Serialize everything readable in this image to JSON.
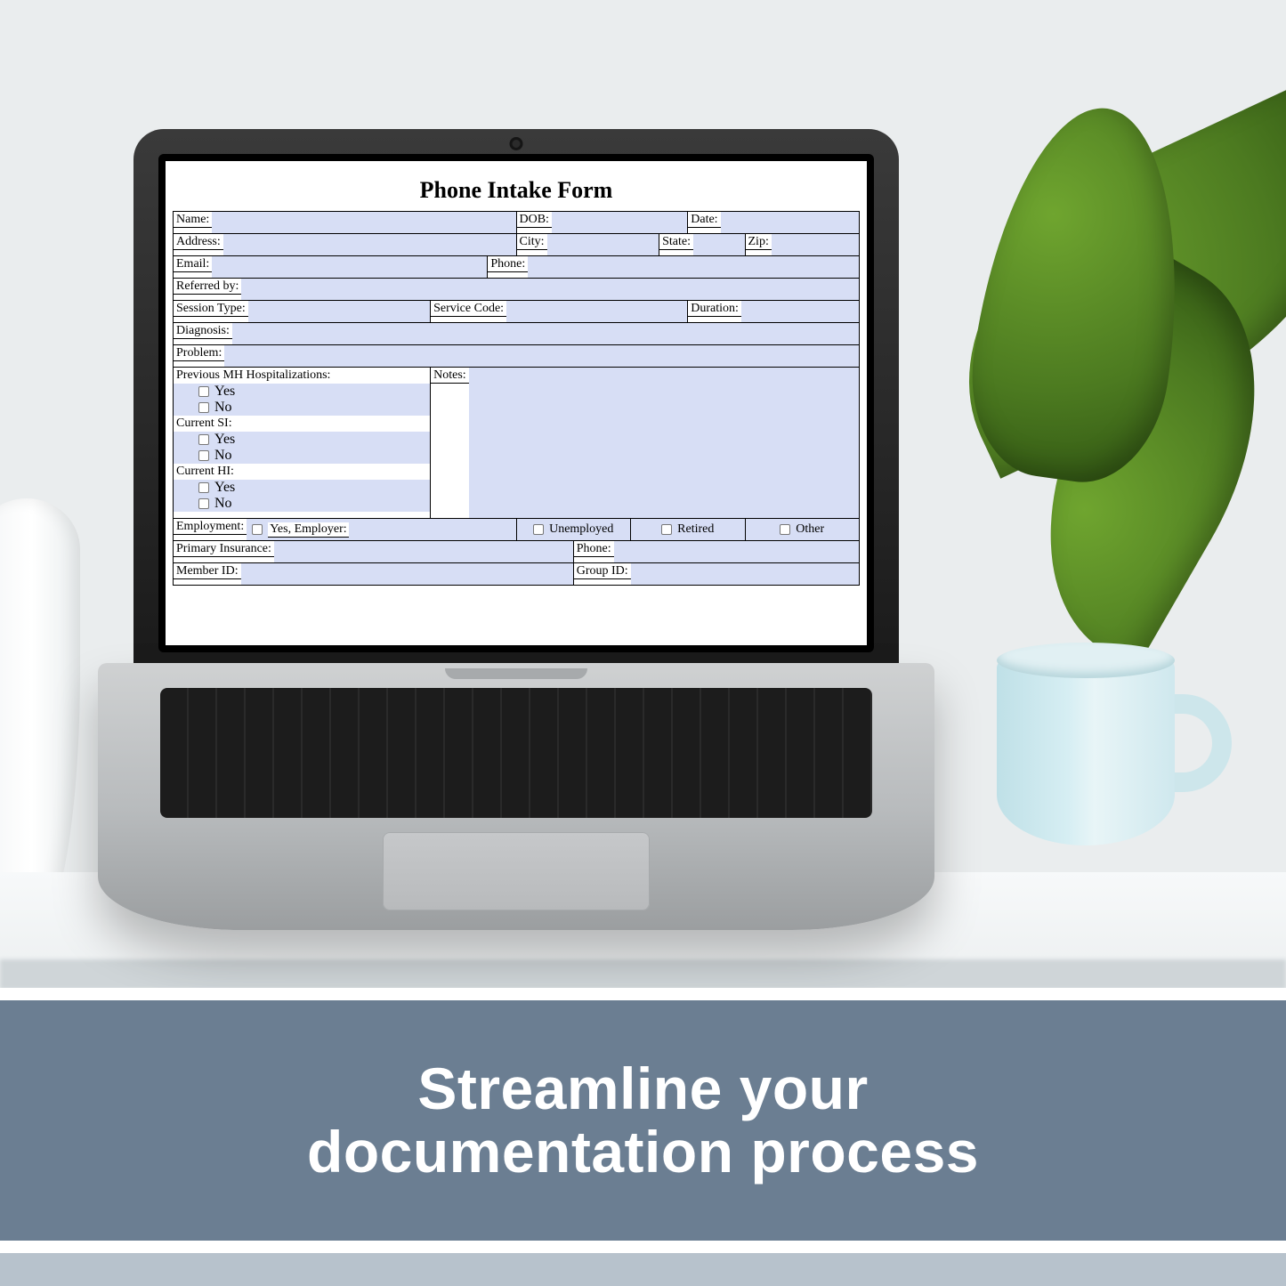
{
  "banner": {
    "headline": "Streamline your\ndocumentation process"
  },
  "form": {
    "title": "Phone Intake Form",
    "labels": {
      "name": "Name:",
      "dob": "DOB:",
      "date": "Date:",
      "address": "Address:",
      "city": "City:",
      "state": "State:",
      "zip": "Zip:",
      "email": "Email:",
      "phone": "Phone:",
      "referred_by": "Referred by:",
      "session_type": "Session Type:",
      "service_code": "Service Code:",
      "duration": "Duration:",
      "diagnosis": "Diagnosis:",
      "problem": "Problem:",
      "prev_mh": "Previous MH Hospitalizations:",
      "current_si": "Current SI:",
      "current_hi": "Current HI:",
      "yes": "Yes",
      "no": "No",
      "notes": "Notes:",
      "employment": "Employment:",
      "yes_employer": "Yes, Employer:",
      "unemployed": "Unemployed",
      "retired": "Retired",
      "other": "Other",
      "primary_insurance": "Primary Insurance:",
      "ins_phone": "Phone:",
      "member_id": "Member ID:",
      "group_id": "Group ID:"
    }
  }
}
